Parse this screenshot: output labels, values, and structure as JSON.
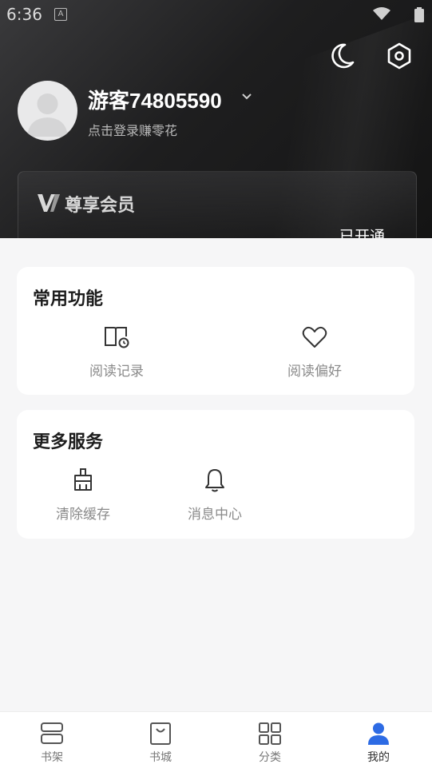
{
  "status_bar": {
    "time": "6:36",
    "notification_glyph": "A"
  },
  "colors": {
    "accent": "#2d6be4",
    "header_dark": "#1e1e1f",
    "card_bg": "#ffffff",
    "page_bg": "#f6f6f7"
  },
  "profile": {
    "username": "游客74805590",
    "login_hint": "点击登录赚零花"
  },
  "vip": {
    "logo": "V",
    "title": "尊享会员",
    "status": "已开通"
  },
  "frequent": {
    "title": "常用功能",
    "items": [
      {
        "label": "阅读记录",
        "icon": "book-history-icon"
      },
      {
        "label": "阅读偏好",
        "icon": "heart-icon"
      }
    ]
  },
  "more_services": {
    "title": "更多服务",
    "items": [
      {
        "label": "清除缓存",
        "icon": "broom-icon"
      },
      {
        "label": "消息中心",
        "icon": "bell-icon"
      }
    ]
  },
  "tabs": [
    {
      "label": "书架",
      "icon": "bookshelf-icon",
      "active": false
    },
    {
      "label": "书城",
      "icon": "shopping-bag-icon",
      "active": false
    },
    {
      "label": "分类",
      "icon": "grid-icon",
      "active": false
    },
    {
      "label": "我的",
      "icon": "person-icon",
      "active": true
    }
  ]
}
